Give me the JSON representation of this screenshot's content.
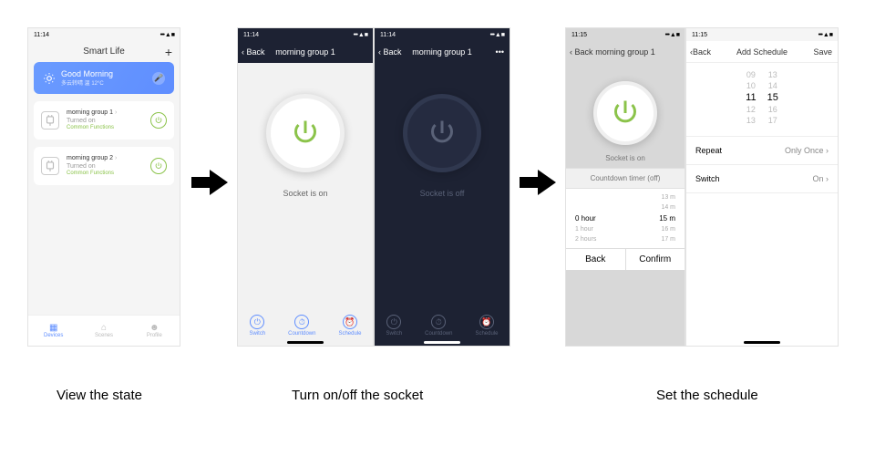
{
  "captions": {
    "s1": "View the state",
    "s2": "Turn on/off the socket",
    "s3": "Set the schedule"
  },
  "time_a": "11:14",
  "time_b": "11:15",
  "smartlife": {
    "title": "Smart Life",
    "weather": {
      "greeting": "Good Morning",
      "sub": "多云转晴 温 12°C"
    },
    "devices": [
      {
        "name": "morning group 1",
        "state": "Turned on",
        "cf": "Common Functions"
      },
      {
        "name": "morning group 2",
        "state": "Turned on",
        "cf": "Common Functions"
      }
    ],
    "tabs": [
      "Devices",
      "Scenes",
      "Profile"
    ]
  },
  "control": {
    "back": "Back",
    "title": "morning group 1",
    "on_label": "Socket is on",
    "off_label": "Socket is off",
    "bot": [
      "Switch",
      "Countdown",
      "Schedule"
    ]
  },
  "countdown": {
    "back": "Back",
    "title": "morning group 1",
    "socket": "Socket is on",
    "ct": "Countdown timer (off)",
    "left": [
      "",
      "",
      "0 hour",
      "1 hour",
      "2 hours"
    ],
    "right": [
      "13 m",
      "14 m",
      "15 m",
      "16 m",
      "17 m"
    ],
    "btn_back": "Back",
    "btn_confirm": "Confirm"
  },
  "schedule": {
    "back": "Back",
    "title": "Add Schedule",
    "save": "Save",
    "hours": [
      "09",
      "10",
      "11",
      "12",
      "13"
    ],
    "mins": [
      "13",
      "14",
      "15",
      "16",
      "17"
    ],
    "rows": [
      {
        "label": "Repeat",
        "value": "Only Once"
      },
      {
        "label": "Switch",
        "value": "On"
      }
    ]
  }
}
